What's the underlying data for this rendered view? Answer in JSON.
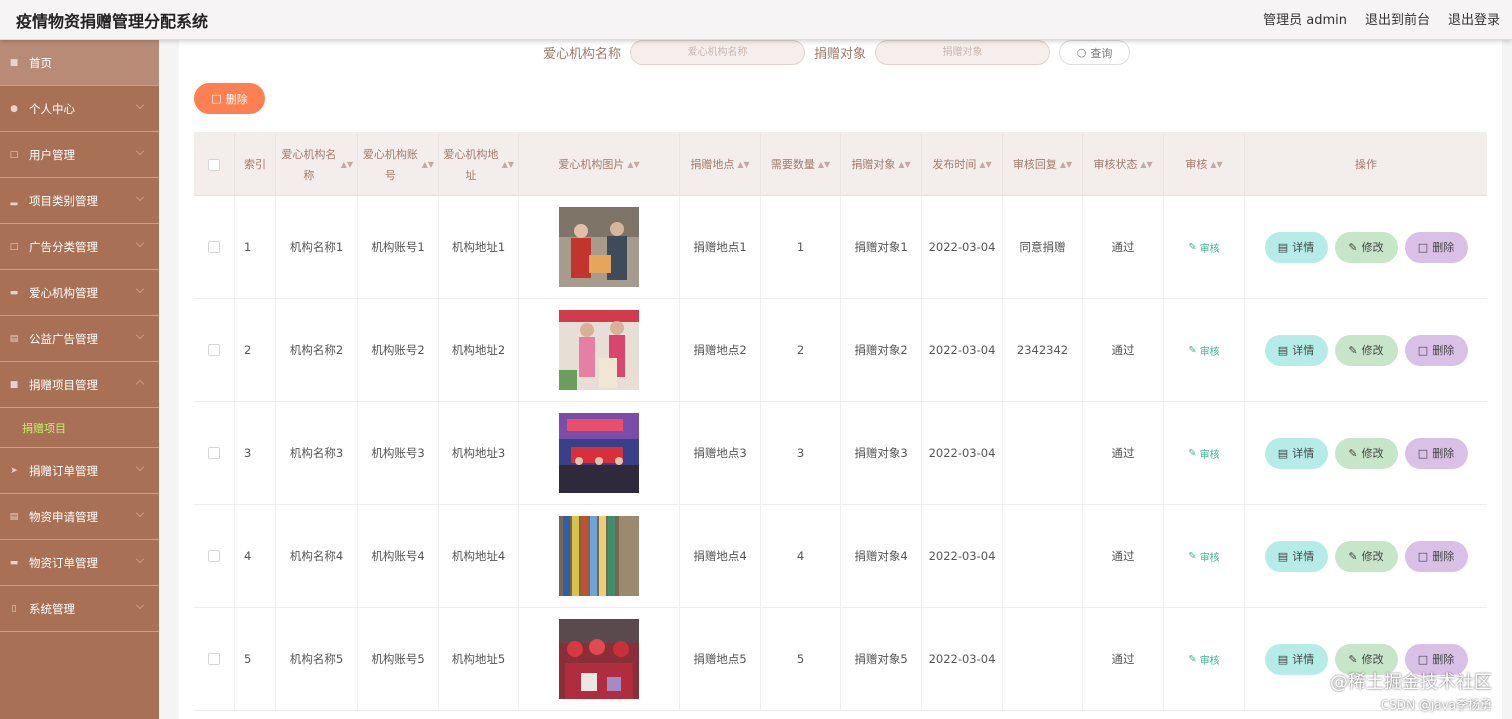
{
  "header": {
    "title": "疫情物资捐赠管理分配系统",
    "admin": "管理员 admin",
    "to_front": "退出到前台",
    "logout": "退出登录"
  },
  "sidebar": {
    "items": [
      {
        "label": "首页",
        "icon": "home-icon"
      },
      {
        "label": "个人中心",
        "icon": "user-icon"
      },
      {
        "label": "用户管理",
        "icon": "users-icon"
      },
      {
        "label": "项目类别管理",
        "icon": "bar-chart-icon"
      },
      {
        "label": "广告分类管理",
        "icon": "copy-icon"
      },
      {
        "label": "爱心机构管理",
        "icon": "card-icon"
      },
      {
        "label": "公益广告管理",
        "icon": "image-icon"
      },
      {
        "label": "捐赠项目管理",
        "icon": "list-icon"
      },
      {
        "label": "捐赠订单管理",
        "icon": "send-icon"
      },
      {
        "label": "物资申请管理",
        "icon": "doc-icon"
      },
      {
        "label": "物资订单管理",
        "icon": "message-icon"
      },
      {
        "label": "系统管理",
        "icon": "phone-icon"
      }
    ],
    "sub_active": "捐赠项目"
  },
  "search": {
    "org_label": "爱心机构名称",
    "org_placeholder": "爱心机构名称",
    "target_label": "捐赠对象",
    "target_placeholder": "捐赠对象",
    "button": "查询"
  },
  "bulk_delete": "删除",
  "table": {
    "headers": [
      "索引",
      "爱心机构名称",
      "爱心机构账号",
      "爱心机构地址",
      "爱心机构图片",
      "捐赠地点",
      "需要数量",
      "捐赠对象",
      "发布时间",
      "审核回复",
      "审核状态",
      "审核",
      "操作"
    ],
    "rows": [
      {
        "index": "1",
        "name": "机构名称1",
        "account": "机构账号1",
        "address": "机构地址1",
        "place": "捐赠地点1",
        "qty": "1",
        "target": "捐赠对象1",
        "time": "2022-03-04",
        "reply": "同意捐赠",
        "status": "通过"
      },
      {
        "index": "2",
        "name": "机构名称2",
        "account": "机构账号2",
        "address": "机构地址2",
        "place": "捐赠地点2",
        "qty": "2",
        "target": "捐赠对象2",
        "time": "2022-03-04",
        "reply": "2342342",
        "status": "通过"
      },
      {
        "index": "3",
        "name": "机构名称3",
        "account": "机构账号3",
        "address": "机构地址3",
        "place": "捐赠地点3",
        "qty": "3",
        "target": "捐赠对象3",
        "time": "2022-03-04",
        "reply": "",
        "status": "通过"
      },
      {
        "index": "4",
        "name": "机构名称4",
        "account": "机构账号4",
        "address": "机构地址4",
        "place": "捐赠地点4",
        "qty": "4",
        "target": "捐赠对象4",
        "time": "2022-03-04",
        "reply": "",
        "status": "通过"
      },
      {
        "index": "5",
        "name": "机构名称5",
        "account": "机构账号5",
        "address": "机构地址5",
        "place": "捐赠地点5",
        "qty": "5",
        "target": "捐赠对象5",
        "time": "2022-03-04",
        "reply": "",
        "status": "通过"
      }
    ],
    "audit_label": "审核",
    "detail_label": "详情",
    "edit_label": "修改",
    "delete_label": "删除"
  },
  "watermark": {
    "line1": "@稀土掘金技术社区",
    "line2": "CSDN @java李杨勇"
  }
}
